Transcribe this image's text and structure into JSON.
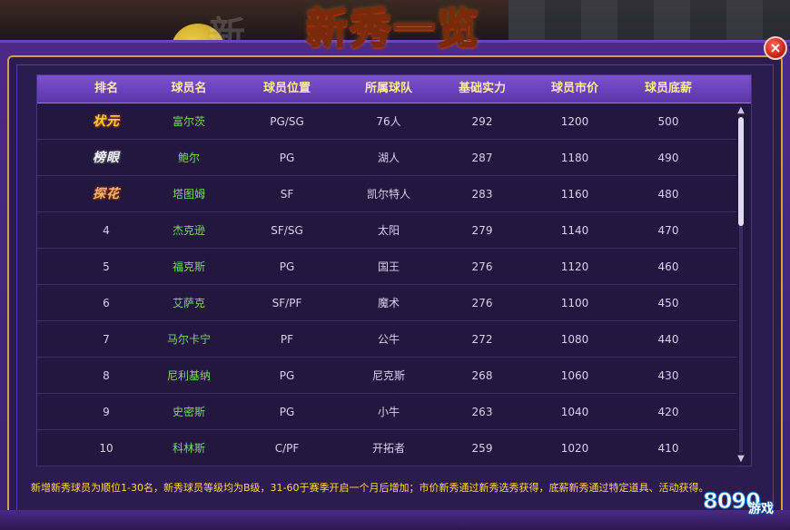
{
  "window": {
    "title": "新秀一览",
    "close_label": "×"
  },
  "table": {
    "headers": [
      "排名",
      "球员名",
      "球员位置",
      "所属球队",
      "基础实力",
      "球员市价",
      "球员底薪"
    ],
    "rows": [
      {
        "rank": "状元",
        "name": "富尔茨",
        "position": "PG/SG",
        "team": "76人",
        "power": "292",
        "price": "1200",
        "salary": "500"
      },
      {
        "rank": "榜眼",
        "name": "鲍尔",
        "position": "PG",
        "team": "湖人",
        "power": "287",
        "price": "1180",
        "salary": "490"
      },
      {
        "rank": "探花",
        "name": "塔图姆",
        "position": "SF",
        "team": "凯尔特人",
        "power": "283",
        "price": "1160",
        "salary": "480"
      },
      {
        "rank": "4",
        "name": "杰克逊",
        "position": "SF/SG",
        "team": "太阳",
        "power": "279",
        "price": "1140",
        "salary": "470"
      },
      {
        "rank": "5",
        "name": "福克斯",
        "position": "PG",
        "team": "国王",
        "power": "276",
        "price": "1120",
        "salary": "460"
      },
      {
        "rank": "6",
        "name": "艾萨克",
        "position": "SF/PF",
        "team": "魔术",
        "power": "276",
        "price": "1100",
        "salary": "450"
      },
      {
        "rank": "7",
        "name": "马尔卡宁",
        "position": "PF",
        "team": "公牛",
        "power": "272",
        "price": "1080",
        "salary": "440"
      },
      {
        "rank": "8",
        "name": "尼利基纳",
        "position": "PG",
        "team": "尼克斯",
        "power": "268",
        "price": "1060",
        "salary": "430"
      },
      {
        "rank": "9",
        "name": "史密斯",
        "position": "PG",
        "team": "小牛",
        "power": "263",
        "price": "1040",
        "salary": "420"
      },
      {
        "rank": "10",
        "name": "科林斯",
        "position": "C/PF",
        "team": "开拓者",
        "power": "259",
        "price": "1020",
        "salary": "410"
      }
    ]
  },
  "scrollbar": {
    "up_glyph": "▲",
    "down_glyph": "▼",
    "position_fraction": 0.0
  },
  "footer": {
    "note": "新增新秀球员为顺位1-30名，新秀球员等级均为B级，31-60于赛季开启一个月后增加；市价新秀通过新秀选秀获得，底薪新秀通过特定道具、活动获得。"
  },
  "watermark": {
    "number": "8090",
    "label": "游戏"
  },
  "background": {
    "ghost_text": "新"
  },
  "colors": {
    "panel": "#4b2a86",
    "header": "#7a52cf",
    "header_text": "#ffe9a6",
    "name_text": "#7fd86a",
    "note_text": "#ffd84a",
    "gold": "#ffcc33"
  }
}
